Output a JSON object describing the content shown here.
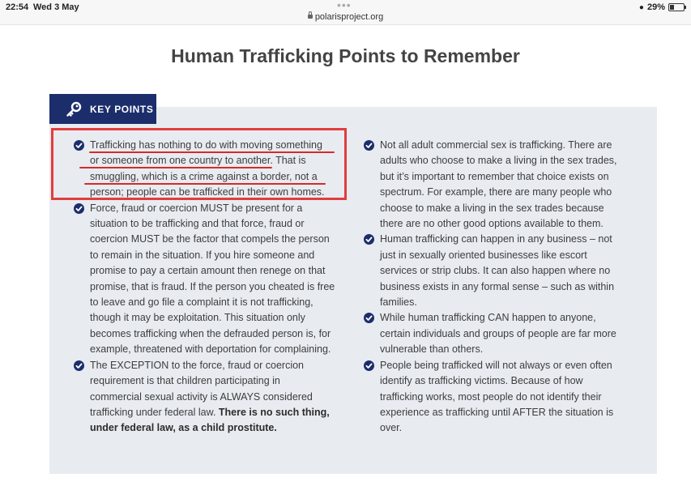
{
  "status_bar": {
    "time": "22:54",
    "date": "Wed 3 May",
    "url": "polarisproject.org",
    "battery": "29%",
    "battery_level": 0.29
  },
  "page": {
    "title": "Human Trafficking Points to Remember"
  },
  "key_points": {
    "tab_label": "KEY POINTS",
    "left": [
      {
        "lines": [
          "Trafficking has nothing to do with moving something",
          "or someone from one country to another. That is",
          "smuggling, which is a crime against a border, not a",
          "person; people can be trafficked in their own homes."
        ]
      },
      {
        "lines": [
          "Force, fraud or coercion MUST be present for a",
          "situation to be trafficking and that force, fraud or",
          "coercion MUST be the factor that compels the person",
          "to remain in the situation. If you hire someone and",
          "promise to pay a certain amount then renege on that",
          "promise, that is fraud. If the person you cheated is free",
          "to leave and go file a complaint it is not trafficking,",
          "though it may be exploitation. This situation only",
          "becomes trafficking when the defrauded person is, for",
          "example, threatened with deportation for complaining."
        ]
      },
      {
        "lines": [
          "The EXCEPTION to the force, fraud or coercion",
          "requirement is that children participating in",
          "commercial sexual activity is ALWAYS considered"
        ],
        "mixed_line": {
          "plain": "trafficking under federal law. ",
          "bold": "There is no such thing,"
        },
        "bold_line": "under federal law, as a child prostitute."
      }
    ],
    "right": [
      {
        "lines": [
          "Not all adult commercial sex is trafficking. There are",
          "adults who choose to make a living in the sex trades,",
          "but it’s important to remember that choice exists on",
          "spectrum. For example, there are many people who",
          "choose to make a living in the sex trades because",
          "there are no other good options available to them."
        ]
      },
      {
        "lines": [
          "Human trafficking can happen in any business – not",
          "just in sexually oriented businesses like escort",
          "services or strip clubs. It can also happen where no",
          "business exists in any formal sense – such as within",
          "families."
        ]
      },
      {
        "lines": [
          "While human trafficking CAN happen to anyone,",
          "certain individuals and groups of people are far more",
          "vulnerable than others."
        ]
      },
      {
        "lines": [
          "People being trafficked will not always or even often",
          "identify as trafficking victims. Because of how",
          "trafficking works, most people do not identify their",
          "experience as trafficking until AFTER the situation is",
          "over."
        ]
      }
    ]
  },
  "colors": {
    "navy": "#1b2d6b",
    "panel": "#e8ecf1",
    "annotation_red": "#e23d3d"
  },
  "icons": [
    "wifi-icon",
    "battery-icon",
    "lock-icon",
    "key-icon",
    "check-circle-icon"
  ]
}
